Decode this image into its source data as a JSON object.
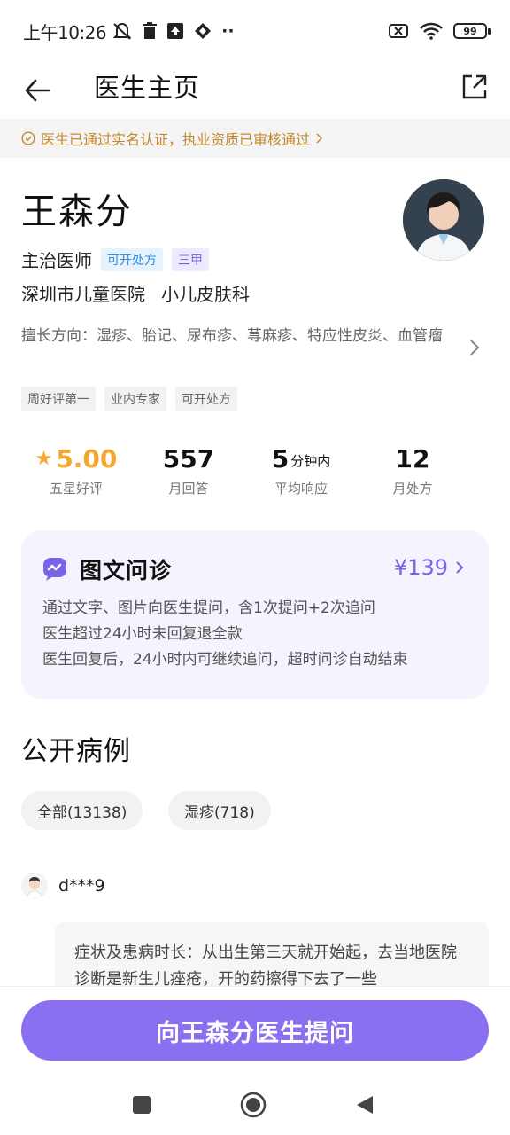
{
  "status_bar": {
    "time": "上午10:26",
    "extra": "··",
    "battery": "99"
  },
  "header": {
    "title": "医生主页"
  },
  "verified": {
    "text": "医生已通过实名认证，执业资质已审核通过"
  },
  "doctor": {
    "name": "王森分",
    "title": "主治医师",
    "tag_prescribe": "可开处方",
    "tag_grade": "三甲",
    "hospital": "深圳市儿童医院",
    "department": "小儿皮肤科",
    "specialty": "擅长方向：湿疹、胎记、尿布疹、荨麻疹、特应性皮炎、血管瘤",
    "tags": [
      "周好评第一",
      "业内专家",
      "可开处方"
    ]
  },
  "stats": {
    "rating": "5.00",
    "rating_label": "五星好评",
    "answers": "557",
    "answers_label": "月回答",
    "response_num": "5",
    "response_unit": "分钟内",
    "response_label": "平均响应",
    "prescriptions": "12",
    "prescriptions_label": "月处方"
  },
  "consult": {
    "title": "图文问诊",
    "price": "¥139",
    "lines": [
      "通过文字、图片向医生提问，含1次提问+2次追问",
      "医生超过24小时未回复退全款",
      "医生回复后，24小时内可继续追问，超时问诊自动结束"
    ]
  },
  "cases": {
    "title": "公开病例",
    "filters": [
      "全部(13138)",
      "湿疹(718)"
    ],
    "user": "d***9",
    "content": "症状及患病时长：从出生第三天就开始起，去当地医院诊断是新生儿痤疮，开的药擦得下去了一些"
  },
  "action": {
    "ask_label": "向王森分医生提问"
  },
  "colors": {
    "accent": "#8a70f0",
    "price": "#7b63e9",
    "rating": "#f4a72c",
    "verified": "#c38a2c"
  }
}
